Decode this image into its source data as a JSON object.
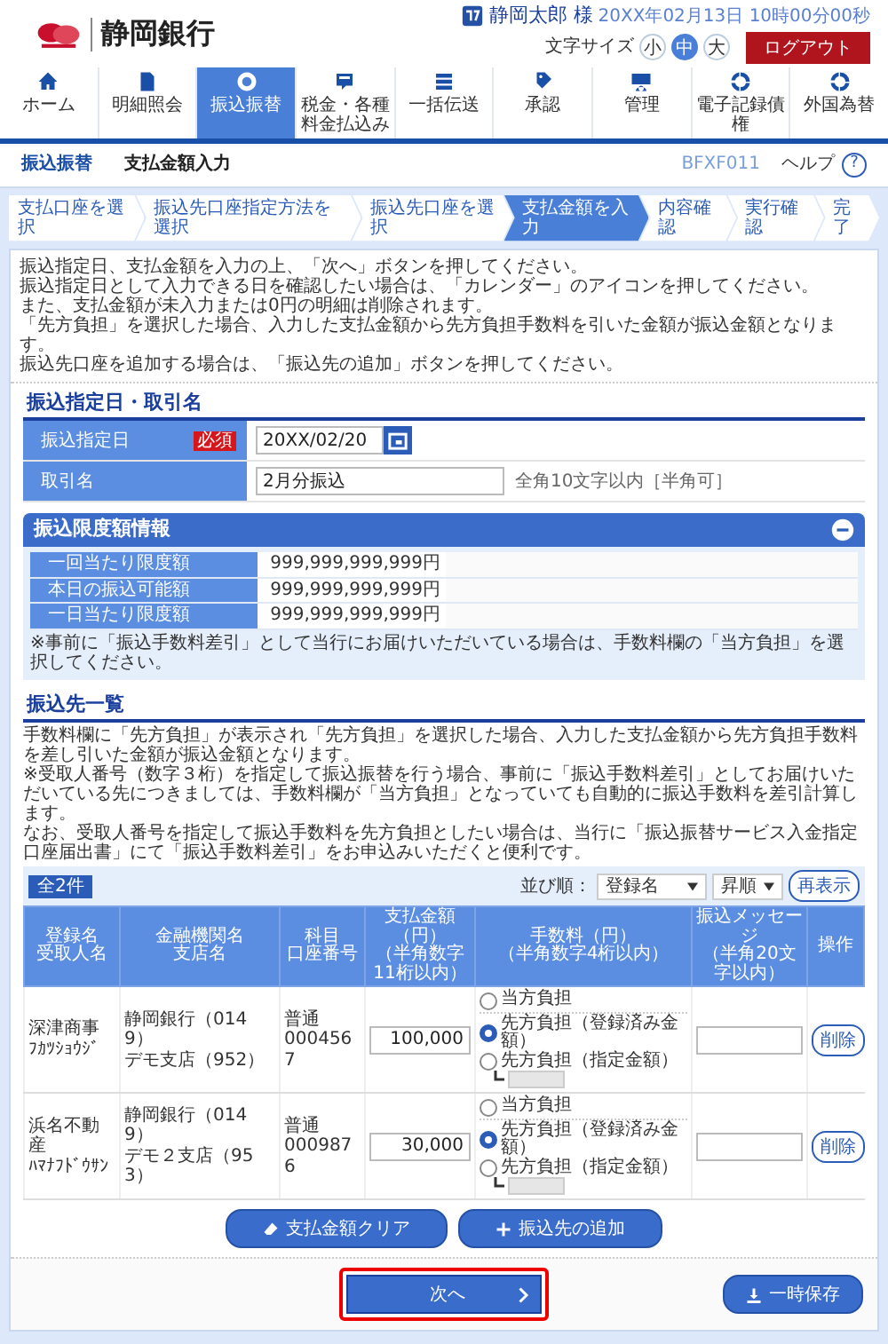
{
  "header": {
    "bank_name": "静岡銀行",
    "user_name": "静岡太郎 様",
    "datetime": "20XX年02月13日 10時00分00秒",
    "font_size_label": "文字サイズ",
    "font_sizes": [
      {
        "label": "小",
        "selected": false
      },
      {
        "label": "中",
        "selected": true
      },
      {
        "label": "大",
        "selected": false
      }
    ],
    "logout": "ログアウト"
  },
  "nav": [
    {
      "label": "ホーム",
      "selected": false
    },
    {
      "label": "明細照会",
      "selected": false
    },
    {
      "label": "振込振替",
      "selected": true
    },
    {
      "label": "税金・各種料金払込み",
      "selected": false
    },
    {
      "label": "一括伝送",
      "selected": false
    },
    {
      "label": "承認",
      "selected": false
    },
    {
      "label": "管理",
      "selected": false
    },
    {
      "label": "電子記録債権",
      "selected": false
    },
    {
      "label": "外国為替",
      "selected": false
    }
  ],
  "page": {
    "category": "振込振替",
    "title": "支払金額入力",
    "screen_id": "BFXF011",
    "help": "ヘルプ",
    "help_icon": "?"
  },
  "steps": [
    {
      "label": "支払口座を選択",
      "selected": false
    },
    {
      "label": "振込先口座指定方法を選択",
      "selected": false
    },
    {
      "label": "振込先口座を選択",
      "selected": false
    },
    {
      "label": "支払金額を入力",
      "selected": true
    },
    {
      "label": "内容確認",
      "selected": false
    },
    {
      "label": "実行確認",
      "selected": false
    },
    {
      "label": "完了",
      "selected": false
    }
  ],
  "instructions": [
    "振込指定日、支払金額を入力の上、「次へ」ボタンを押してください。",
    "振込指定日として入力できる日を確認したい場合は、「カレンダー」のアイコンを押してください。",
    "また、支払金額が未入力または0円の明細は削除されます。",
    "「先方負担」を選択した場合、入力した支払金額から先方負担手数料を引いた金額が振込金額となります。",
    "振込先口座を追加する場合は、「振込先の追加」ボタンを押してください。"
  ],
  "transfer_info": {
    "title": "振込指定日・取引名",
    "rows": [
      {
        "kind": "date",
        "label": "振込指定日",
        "required": "必須",
        "value": "20XX/02/20"
      },
      {
        "kind": "text",
        "label": "取引名",
        "value": "2月分振込",
        "hint": "全角10文字以内［半角可］"
      }
    ]
  },
  "limit_panel": {
    "title": "振込限度額情報",
    "expanded": true,
    "rows": [
      {
        "label": "一回当たり限度額",
        "value": "999,999,999,999円"
      },
      {
        "label": "本日の振込可能額",
        "value": "999,999,999,999円"
      },
      {
        "label": "一日当たり限度額",
        "value": "999,999,999,999円"
      }
    ],
    "note": "※事前に「振込手数料差引」として当行にお届けいただいている場合は、手数料欄の「当方負担」を選択してください。"
  },
  "payee_list": {
    "title": "振込先一覧",
    "notes": [
      "手数料欄に「先方負担」が表示され「先方負担」を選択した場合、入力した支払金額から先方負担手数料を差し引いた金額が振込金額となります。",
      "※受取人番号（数字３桁）を指定して振込振替を行う場合、事前に「振込手数料差引」としてお届けいただいている先につきましては、手数料欄が「当方負担」となっていても自動的に振込手数料を差引計算します。",
      "なお、受取人番号を指定して振込手数料を先方負担としたい場合は、当行に「振込振替サービス入金指定口座届出書」にて「振込手数料差引」をお申込みいただくと便利です。"
    ],
    "count": "全2件",
    "sort_label": "並び順：",
    "sort_field": "登録名",
    "sort_order": "昇順",
    "refresh": "再表示",
    "columns": [
      {
        "lines": [
          "登録名",
          "受取人名"
        ]
      },
      {
        "lines": [
          "金融機関名",
          "支店名"
        ]
      },
      {
        "lines": [
          "科目",
          "口座番号"
        ]
      },
      {
        "lines": [
          "支払金額（円）",
          "（半角数字11桁以内）"
        ]
      },
      {
        "lines": [
          "手数料（円）",
          "（半角数字4桁以内）"
        ]
      },
      {
        "lines": [
          "振込メッセージ",
          "（半角20文字以内）"
        ]
      },
      {
        "lines": [
          "操作"
        ]
      }
    ],
    "rows": [
      {
        "name": "深津商事",
        "kana": "ﾌｶﾂｼｮｳｼﾞ",
        "bank": "静岡銀行（0149）",
        "branch": "デモ支店（952）",
        "account_type": "普通",
        "account_number": "0004567",
        "amount": "100,000",
        "fee_options": [
          {
            "label": "当方負担",
            "selected": false
          },
          {
            "label": "先方負担（登録済み金額）",
            "selected": true
          },
          {
            "label": "先方負担（指定金額）",
            "selected": false
          }
        ],
        "delete": "削除"
      },
      {
        "name": "浜名不動産",
        "kana": "ﾊﾏﾅﾌﾄﾞｳｻﾝ",
        "bank": "静岡銀行（0149）",
        "branch": "デモ２支店（953）",
        "account_type": "普通",
        "account_number": "0009876",
        "amount": "30,000",
        "fee_options": [
          {
            "label": "当方負担",
            "selected": false
          },
          {
            "label": "先方負担（登録済み金額）",
            "selected": true
          },
          {
            "label": "先方負担（指定金額）",
            "selected": false
          }
        ],
        "delete": "削除"
      }
    ]
  },
  "actions": {
    "clear": "支払金額クリア",
    "add": "振込先の追加"
  },
  "footer": {
    "next": "次へ",
    "next_highlighted": true,
    "save": "一時保存"
  }
}
